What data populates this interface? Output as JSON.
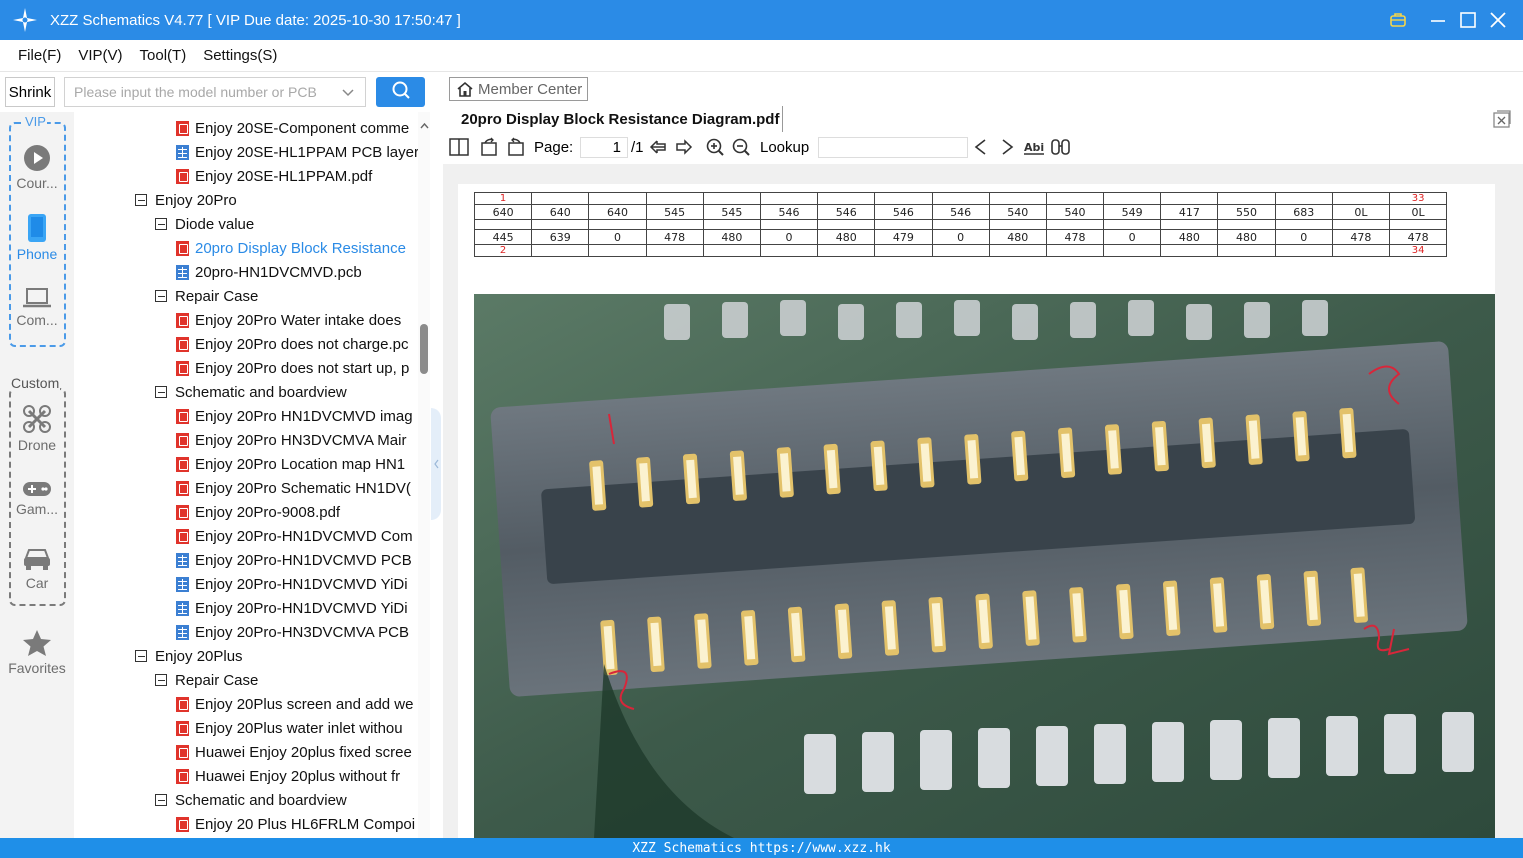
{
  "window": {
    "title": "XZZ Schematics V4.77 [ VIP Due date: 2025-10-30 17:50:47 ]"
  },
  "menu": [
    "File(F)",
    "VIP(V)",
    "Tool(T)",
    "Settings(S)"
  ],
  "search": {
    "shrink_label": "Shrink",
    "placeholder": "Please input the model number or PCB"
  },
  "sidebar": {
    "vip_label": "VIP",
    "custom_label": "Custom",
    "items": [
      {
        "label": "Cour...",
        "icon": "play-icon"
      },
      {
        "label": "Phone",
        "icon": "phone-icon"
      },
      {
        "label": "Com...",
        "icon": "laptop-icon"
      },
      {
        "label": "Drone",
        "icon": "drone-icon"
      },
      {
        "label": "Gam...",
        "icon": "gamepad-icon"
      },
      {
        "label": "Car",
        "icon": "car-icon"
      },
      {
        "label": "Favorites",
        "icon": "star-icon"
      }
    ]
  },
  "tree": [
    {
      "label": "Enjoy 20SE-Component comme",
      "type": "pdf",
      "level": 2
    },
    {
      "label": "Enjoy 20SE-HL1PPAM PCB layer",
      "type": "pcb",
      "level": 2
    },
    {
      "label": "Enjoy 20SE-HL1PPAM.pdf",
      "type": "pdf",
      "level": 2
    },
    {
      "label": "Enjoy 20Pro",
      "type": "folder",
      "level": 0
    },
    {
      "label": "Diode value",
      "type": "folder",
      "level": 1
    },
    {
      "label": "20pro Display Block Resistance",
      "type": "pdf",
      "level": 2,
      "selected": true
    },
    {
      "label": "20pro-HN1DVCMVD.pcb",
      "type": "pcb",
      "level": 2
    },
    {
      "label": "Repair Case",
      "type": "folder",
      "level": 1
    },
    {
      "label": "Enjoy 20Pro Water intake does",
      "type": "pdf",
      "level": 2
    },
    {
      "label": "Enjoy 20Pro does not charge.pc",
      "type": "pdf",
      "level": 2
    },
    {
      "label": "Enjoy 20Pro does not start up, p",
      "type": "pdf",
      "level": 2
    },
    {
      "label": "Schematic and boardview",
      "type": "folder",
      "level": 1
    },
    {
      "label": "Enjoy 20Pro HN1DVCMVD imag",
      "type": "pdf",
      "level": 2
    },
    {
      "label": "Enjoy 20Pro HN3DVCMVA Mair",
      "type": "pdf",
      "level": 2
    },
    {
      "label": "Enjoy 20Pro Location map HN1",
      "type": "pdf",
      "level": 2
    },
    {
      "label": "Enjoy 20Pro Schematic HN1DV(",
      "type": "pdf",
      "level": 2
    },
    {
      "label": "Enjoy 20Pro-9008.pdf",
      "type": "pdf",
      "level": 2
    },
    {
      "label": "Enjoy 20Pro-HN1DVCMVD Com",
      "type": "pdf",
      "level": 2
    },
    {
      "label": "Enjoy 20Pro-HN1DVCMVD PCB",
      "type": "pcb",
      "level": 2
    },
    {
      "label": "Enjoy 20Pro-HN1DVCMVD YiDi",
      "type": "pcb",
      "level": 2
    },
    {
      "label": "Enjoy 20Pro-HN1DVCMVD YiDi",
      "type": "pcb",
      "level": 2
    },
    {
      "label": "Enjoy 20Pro-HN3DVCMVA PCB",
      "type": "pcb",
      "level": 2
    },
    {
      "label": "Enjoy 20Plus",
      "type": "folder",
      "level": 0
    },
    {
      "label": "Repair Case",
      "type": "folder",
      "level": 1
    },
    {
      "label": "Enjoy 20Plus screen and add we",
      "type": "pdf",
      "level": 2
    },
    {
      "label": "Enjoy 20Plus water inlet withou",
      "type": "pdf",
      "level": 2
    },
    {
      "label": "Huawei Enjoy 20plus fixed scree",
      "type": "pdf",
      "level": 2
    },
    {
      "label": "Huawei Enjoy 20plus without fr",
      "type": "pdf",
      "level": 2
    },
    {
      "label": "Schematic and boardview",
      "type": "folder",
      "level": 1
    },
    {
      "label": "Enjoy 20 Plus HL6FRLM Compoi",
      "type": "pdf",
      "level": 2
    }
  ],
  "viewer": {
    "member_center": "Member Center",
    "doc_title": "20pro Display Block Resistance Diagram.pdf",
    "page_label": "Page:",
    "page_value": "1",
    "page_total": "/1",
    "lookup_label": "Lookup",
    "lookup_value": ""
  },
  "resistance_table": {
    "top_pins": [
      "1",
      "",
      "",
      "",
      "",
      "",
      "",
      "",
      "",
      "",
      "",
      "",
      "",
      "",
      "",
      "",
      "",
      "33"
    ],
    "row1": [
      "640",
      "640",
      "640",
      "545",
      "545",
      "546",
      "546",
      "546",
      "546",
      "540",
      "540",
      "549",
      "417",
      "550",
      "683",
      "0L",
      "0L"
    ],
    "row2": [
      "445",
      "639",
      "0",
      "478",
      "480",
      "0",
      "480",
      "479",
      "0",
      "480",
      "478",
      "0",
      "480",
      "480",
      "0",
      "478",
      "478"
    ],
    "bottom_pins": [
      "2",
      "",
      "",
      "",
      "",
      "",
      "",
      "",
      "",
      "",
      "",
      "",
      "",
      "",
      "",
      "",
      "",
      "34"
    ]
  },
  "statusbar": {
    "text": "XZZ Schematics https://www.xzz.hk"
  },
  "colors": {
    "accent": "#2b8be6",
    "pdf_icon": "#e0332b",
    "pcb_icon": "#3b7fd2"
  }
}
